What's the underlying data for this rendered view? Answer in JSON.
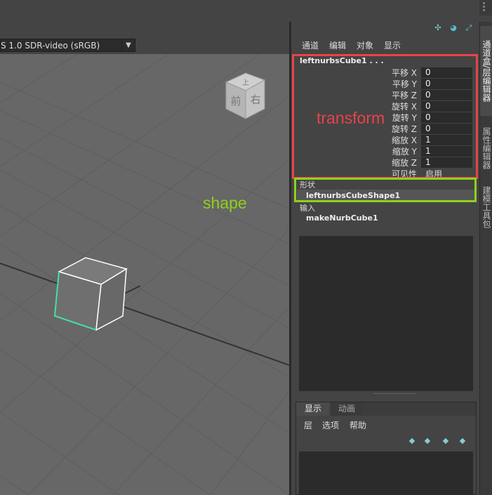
{
  "viewport": {
    "colorspace_label": "S 1.0 SDR-video (sRGB)",
    "viewcube": {
      "top": "上",
      "front": "前",
      "right": "右"
    }
  },
  "channelbox": {
    "menu": [
      "通道",
      "编辑",
      "对象",
      "显示"
    ],
    "object_name": "leftnurbsCube1 . . .",
    "attrs": [
      {
        "label": "平移 X",
        "value": "0"
      },
      {
        "label": "平移 Y",
        "value": "0"
      },
      {
        "label": "平移 Z",
        "value": "0"
      },
      {
        "label": "旋转 X",
        "value": "0"
      },
      {
        "label": "旋转 Y",
        "value": "0"
      },
      {
        "label": "旋转 Z",
        "value": "0"
      },
      {
        "label": "缩放 X",
        "value": "1"
      },
      {
        "label": "缩放 Y",
        "value": "1"
      },
      {
        "label": "缩放 Z",
        "value": "1"
      }
    ],
    "visibility": {
      "label": "可见性",
      "value": "启用"
    },
    "shapes_header": "形状",
    "shape_name": "leftnurbsCubeShape1",
    "inputs_header": "输入",
    "input_name": "makeNurbCube1"
  },
  "annotations": {
    "transform": "transform",
    "shape": "shape",
    "transform_color": "#e8434a",
    "shape_color": "#8fd11c"
  },
  "layer_editor": {
    "tabs": [
      "显示",
      "动画"
    ],
    "menu": [
      "层",
      "选项",
      "帮助"
    ]
  },
  "side_tabs": [
    "通道盒/层编辑器",
    "属性编辑器",
    "建模工具包"
  ],
  "colors": {
    "panel_bg": "#444444",
    "viewport_bg": "#676767",
    "field_bg": "#2b2b2b",
    "selected_edge": "#40e0a0"
  }
}
